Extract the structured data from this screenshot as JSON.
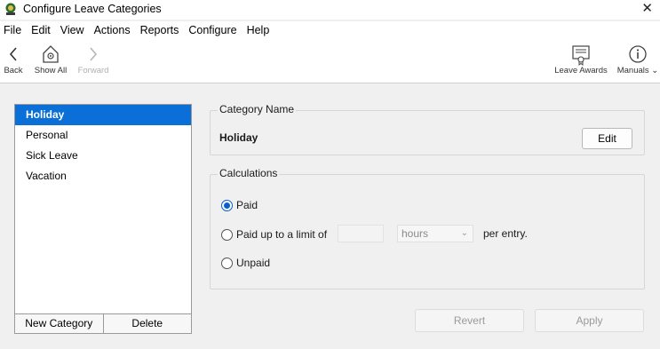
{
  "window": {
    "title": "Configure Leave Categories",
    "close_glyph": "✕"
  },
  "menu": [
    "File",
    "Edit",
    "View",
    "Actions",
    "Reports",
    "Configure",
    "Help"
  ],
  "toolbar": {
    "back": "Back",
    "show_all": "Show All",
    "forward": "Forward",
    "leave_awards": "Leave Awards",
    "manuals": "Manuals",
    "manuals_chevron": "⌄"
  },
  "categories": {
    "items": [
      "Holiday",
      "Personal",
      "Sick Leave",
      "Vacation"
    ],
    "selected_index": 0,
    "new_button": "New Category",
    "delete_button": "Delete"
  },
  "category_name": {
    "group_title": "Category Name",
    "value": "Holiday",
    "edit_button": "Edit"
  },
  "calculations": {
    "group_title": "Calculations",
    "paid": "Paid",
    "paid_limit": "Paid up to a limit of",
    "limit_value": "",
    "unit": "hours",
    "per_entry": "per entry.",
    "unpaid": "Unpaid",
    "selected": "Paid"
  },
  "actions": {
    "revert": "Revert",
    "apply": "Apply"
  },
  "colors": {
    "selection": "#0a6fd6",
    "radio_accent": "#0a5fcf"
  }
}
